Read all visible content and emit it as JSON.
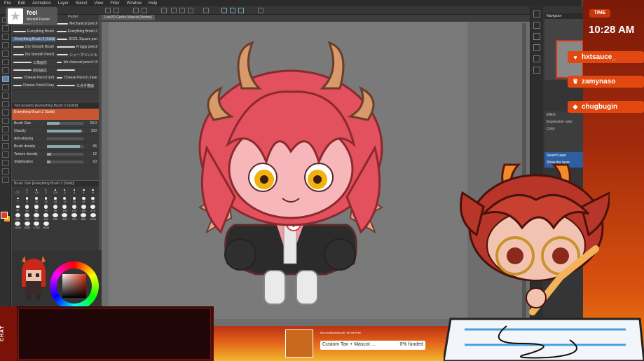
{
  "menu": [
    "File",
    "Edit",
    "Animation",
    "Layer",
    "Select",
    "View",
    "Filter",
    "Window",
    "Help"
  ],
  "profile": {
    "name": "feel",
    "subtitle": "Montell Frazier"
  },
  "brush_list": [
    [
      {
        "label": "Pencil",
        "sel": false
      },
      {
        "label": "Mechanical pencil",
        "sel": false
      }
    ],
    [
      {
        "label": "Everything Brush",
        "sel": false
      },
      {
        "label": "Everything Brush 2",
        "sel": false
      }
    ],
    [
      {
        "label": "Everything Brush 3 (Solid)",
        "sel": true
      },
      {
        "label": "SOOL Square pen",
        "sel": false
      }
    ],
    [
      {
        "label": "Dry Smooth Brush",
        "sel": false
      },
      {
        "label": "Froggy pencil",
        "sel": false
      }
    ],
    [
      {
        "label": "Dry Smooth Pencil",
        "sel": false
      },
      {
        "label": "シャープペンシル",
        "sel": false
      }
    ],
    [
      {
        "label": "三角画芯",
        "sel": false
      },
      {
        "label": "Ish charcoal pencil <3",
        "sel": false
      }
    ],
    [
      {
        "label": "斜切画芯",
        "sel": false
      },
      {
        "label": "",
        "sel": false
      }
    ],
    [
      {
        "label": "Cheese Pencil Soft",
        "sel": false
      },
      {
        "label": "Cheese Pencil Linear",
        "sel": false
      }
    ],
    [
      {
        "label": "Cheese Pencil Gray",
        "sel": false
      },
      {
        "label": "三点手描画",
        "sel": false
      }
    ]
  ],
  "brush_header_right": "Pastel",
  "tool_property": {
    "title": "Tool property [Everything Brush 3 (Solid)]",
    "sub": "Everything Brush 3 (Solid)",
    "rows": [
      {
        "label": "Brush Size",
        "value": "20.0",
        "fill": 0.35
      },
      {
        "label": "Opacity",
        "value": "100",
        "fill": 0.95
      },
      {
        "label": "Anti-aliasing",
        "value": "",
        "fill": 0
      },
      {
        "label": "Brush density",
        "value": "96",
        "fill": 0.9
      },
      {
        "label": "Texture density",
        "value": "12",
        "fill": 0.12
      },
      {
        "label": "Stabilization",
        "value": "10",
        "fill": 0.1
      }
    ]
  },
  "brush_size": {
    "title": "Brush Size [Everything Brush 3 (Solid)]",
    "sizes": [
      "0.7",
      "1",
      "1.5",
      "2",
      "2.5",
      "3",
      "4",
      "5",
      "6",
      "7",
      "8",
      "10",
      "12",
      "15",
      "17",
      "20",
      "25",
      "30",
      "40",
      "50",
      "60",
      "70",
      "80",
      "100",
      "120",
      "150",
      "170",
      "200",
      "250",
      "300",
      "400",
      "500",
      "600",
      "700",
      "800",
      "1000",
      "1200",
      "1500",
      "1700",
      "2000"
    ]
  },
  "canvas_tab": "Live2D Gecko Mascot (Anime)",
  "navigator_title": "Navigator",
  "layer_property": {
    "effect": "Effect",
    "expr": "Expression color",
    "color": "Color"
  },
  "layer_search": "Search layer",
  "layer_show": "Show the layer",
  "overlay": {
    "time_label": "TIME",
    "time": "10:28 AM",
    "events": [
      {
        "icon": "heart-icon",
        "glyph": "♥",
        "name": "hxtsauce_"
      },
      {
        "icon": "crown-icon",
        "glyph": "♛",
        "name": "zamynaso"
      },
      {
        "icon": "diamond-icon",
        "glyph": "◆",
        "name": "chugbugin"
      }
    ],
    "chat_label": "CHAT"
  },
  "goal": {
    "header": "No contributions yet. Be the first!",
    "title": "Custom Tan + Mascot ...",
    "funded": "0% funded"
  },
  "colors": {
    "accent": "#e1470f",
    "main_color": "#e0411c",
    "sub_color": "#f5a623"
  }
}
